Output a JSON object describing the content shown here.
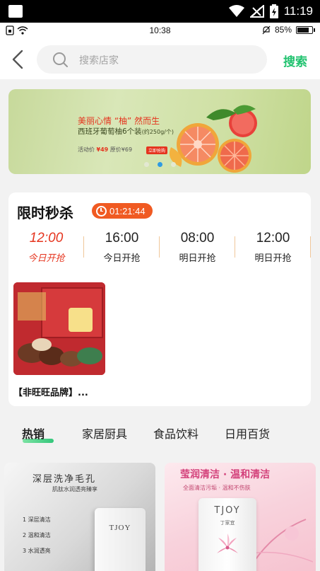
{
  "system_status": {
    "time": "11:19"
  },
  "inner_status": {
    "time": "10:38",
    "battery": "85%",
    "battery_level": 0.85
  },
  "search": {
    "placeholder": "搜索店家",
    "button_label": "搜索"
  },
  "banner": {
    "headline": "美丽心情 “柚” 然而生",
    "subline": "西班牙葡萄柚6个装",
    "subline_spec": "(约250g/个)",
    "price_label": "活动价",
    "price": "¥49",
    "orig_price": "原价¥69",
    "buy_label": "立即抢购",
    "dots": 3,
    "active_dot": 1
  },
  "flash_sale": {
    "title": "限时秒杀",
    "countdown": "01:21:44",
    "slots": [
      {
        "time": "12:00",
        "label": "今日开抢",
        "active": true
      },
      {
        "time": "16:00",
        "label": "今日开抢",
        "active": false
      },
      {
        "time": "08:00",
        "label": "明日开抢",
        "active": false
      },
      {
        "time": "12:00",
        "label": "明日开抢",
        "active": false
      }
    ],
    "product": {
      "name": "【非旺旺品牌】..."
    }
  },
  "tabs": [
    {
      "label": "热销",
      "active": true
    },
    {
      "label": "家居厨具",
      "active": false
    },
    {
      "label": "食品饮料",
      "active": false
    },
    {
      "label": "日用百货",
      "active": false
    }
  ],
  "products": [
    {
      "title": "深层洗净毛孔",
      "subtitle": "肌肽水润透亮臻享",
      "points": [
        "1 深层清洁",
        "2 温和清洁",
        "3 水润透亮"
      ],
      "brand": "TJOY"
    },
    {
      "title": "莹润清洁 · 温和清洁",
      "subtitle": "全面清洁污垢 · 温和不伤肤",
      "brand": "TJOY",
      "brand_sub": "丁家宜"
    }
  ],
  "colors": {
    "accent": "#1fc26e",
    "sale": "#e5341e",
    "countdown": "#f05a22"
  }
}
